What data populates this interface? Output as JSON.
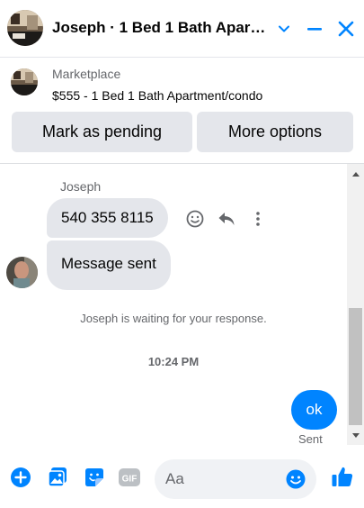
{
  "header": {
    "title": "Joseph · 1 Bed 1 Bath Apartment/condo",
    "icons": [
      "listing-photo",
      "chevron-down-icon",
      "minimize-icon",
      "close-icon"
    ],
    "accent": "#0084ff"
  },
  "marketplace": {
    "label": "Marketplace",
    "listing": "$555 - 1 Bed 1 Bath Apartment/condo",
    "buttons": {
      "mark_pending": "Mark as pending",
      "more_options": "More options"
    }
  },
  "conversation": {
    "sender_name": "Joseph",
    "incoming": [
      {
        "text": "540 355 8115"
      },
      {
        "text": "Message sent"
      }
    ],
    "waiting_notice": "Joseph is waiting for your response.",
    "timestamp": "10:24 PM",
    "outgoing": [
      {
        "text": "ok",
        "status": "Sent"
      }
    ],
    "message_actions": [
      "react-icon",
      "reply-icon",
      "more-icon"
    ],
    "bubble_in_color": "#e4e6eb",
    "bubble_out_color": "#0084ff"
  },
  "composer": {
    "placeholder": "Aa",
    "icons": [
      "plus-icon",
      "photo-icon",
      "sticker-icon",
      "gif-icon",
      "emoji-icon",
      "like-icon"
    ],
    "gif_label": "GIF"
  }
}
